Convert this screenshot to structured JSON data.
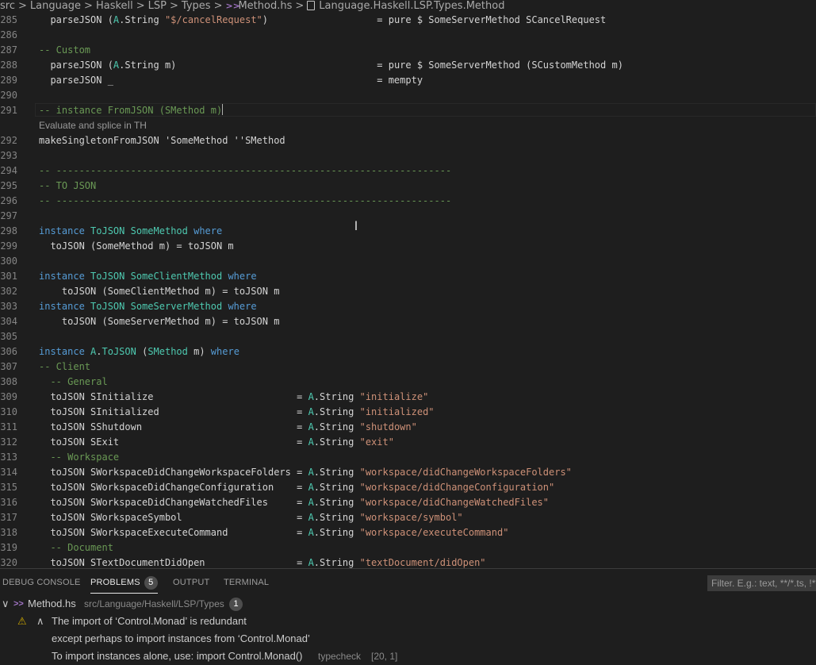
{
  "breadcrumb": {
    "items": [
      "src",
      "Language",
      "Haskell",
      "LSP",
      "Types",
      "Method.hs",
      "Language.Haskell.LSP.Types.Method"
    ],
    "separator": ">"
  },
  "editor": {
    "codelens_text": "Evaluate and splice in TH",
    "lines": [
      {
        "num": "285",
        "code": "  parseJSON (A.String \"$/cancelRequest\")                   = pure $ SomeServerMethod SCancelRequest"
      },
      {
        "num": "286",
        "code": ""
      },
      {
        "num": "287",
        "code": "-- Custom"
      },
      {
        "num": "288",
        "code": "  parseJSON (A.String m)                                   = pure $ SomeServerMethod (SCustomMethod m)"
      },
      {
        "num": "289",
        "code": "  parseJSON _                                              = mempty"
      },
      {
        "num": "290",
        "code": ""
      },
      {
        "num": "291",
        "code": "-- instance FromJSON (SMethod m)"
      },
      {
        "num": "292",
        "code": "makeSingletonFromJSON 'SomeMethod ''SMethod"
      },
      {
        "num": "293",
        "code": ""
      },
      {
        "num": "294",
        "code": "-- ---------------------------------------------------------------------"
      },
      {
        "num": "295",
        "code": "-- TO JSON"
      },
      {
        "num": "296",
        "code": "-- ---------------------------------------------------------------------"
      },
      {
        "num": "297",
        "code": ""
      },
      {
        "num": "298",
        "code": "instance ToJSON SomeMethod where"
      },
      {
        "num": "299",
        "code": "  toJSON (SomeMethod m) = toJSON m"
      },
      {
        "num": "300",
        "code": ""
      },
      {
        "num": "301",
        "code": "instance ToJSON SomeClientMethod where"
      },
      {
        "num": "302",
        "code": "    toJSON (SomeClientMethod m) = toJSON m"
      },
      {
        "num": "303",
        "code": "instance ToJSON SomeServerMethod where"
      },
      {
        "num": "304",
        "code": "    toJSON (SomeServerMethod m) = toJSON m"
      },
      {
        "num": "305",
        "code": ""
      },
      {
        "num": "306",
        "code": "instance A.ToJSON (SMethod m) where"
      },
      {
        "num": "307",
        "code": "-- Client"
      },
      {
        "num": "308",
        "code": "  -- General"
      },
      {
        "num": "309",
        "code": "  toJSON SInitialize                         = A.String \"initialize\""
      },
      {
        "num": "310",
        "code": "  toJSON SInitialized                        = A.String \"initialized\""
      },
      {
        "num": "311",
        "code": "  toJSON SShutdown                           = A.String \"shutdown\""
      },
      {
        "num": "312",
        "code": "  toJSON SExit                               = A.String \"exit\""
      },
      {
        "num": "313",
        "code": "  -- Workspace"
      },
      {
        "num": "314",
        "code": "  toJSON SWorkspaceDidChangeWorkspaceFolders = A.String \"workspace/didChangeWorkspaceFolders\""
      },
      {
        "num": "315",
        "code": "  toJSON SWorkspaceDidChangeConfiguration    = A.String \"workspace/didChangeConfiguration\""
      },
      {
        "num": "316",
        "code": "  toJSON SWorkspaceDidChangeWatchedFiles     = A.String \"workspace/didChangeWatchedFiles\""
      },
      {
        "num": "317",
        "code": "  toJSON SWorkspaceSymbol                    = A.String \"workspace/symbol\""
      },
      {
        "num": "318",
        "code": "  toJSON SWorkspaceExecuteCommand            = A.String \"workspace/executeCommand\""
      },
      {
        "num": "319",
        "code": "  -- Document"
      },
      {
        "num": "320",
        "code": "  toJSON STextDocumentDidOpen                = A.String \"textDocument/didOpen\""
      }
    ]
  },
  "panel": {
    "tabs": [
      {
        "label": "DEBUG CONSOLE"
      },
      {
        "label": "PROBLEMS",
        "badge": "5"
      },
      {
        "label": "OUTPUT"
      },
      {
        "label": "TERMINAL"
      }
    ],
    "filter_placeholder": "Filter. E.g.: text, **/*.ts, !**/node_modules/**",
    "file": {
      "name": "Method.hs",
      "path": "src/Language/Haskell/LSP/Types",
      "count": "1"
    },
    "problem": {
      "message": "The import of ‘Control.Monad’ is redundant",
      "detail1": "except perhaps to import instances from ‘Control.Monad’",
      "detail2": "To import instances alone, use: import Control.Monad()",
      "source": "typecheck",
      "position": "[20, 1]"
    }
  },
  "colors": {
    "background": "#1e1e1e",
    "comment": "#6a9955",
    "keyword": "#569cd6",
    "type": "#4ec9b0",
    "string": "#ce9178",
    "warning": "#cca700"
  }
}
